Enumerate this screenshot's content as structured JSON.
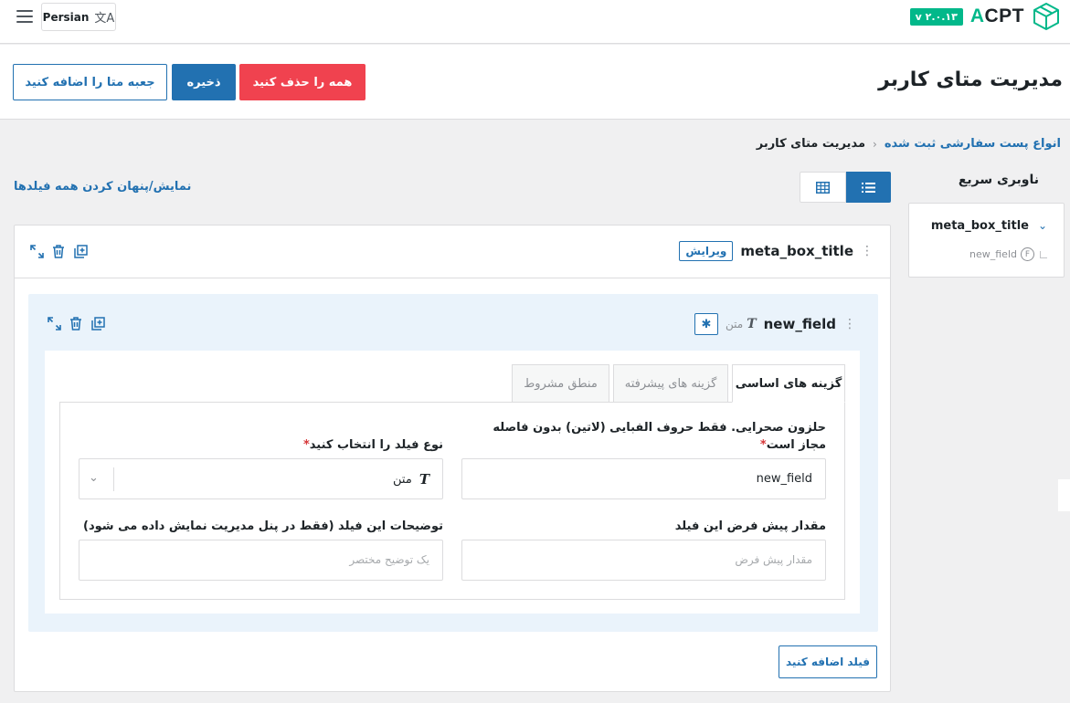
{
  "topbar": {
    "language_label": "Persian",
    "version": "۲.۰.۱۳ v",
    "logo_text_a": "A",
    "logo_text_rest": "CPT"
  },
  "header": {
    "title": "مدیریت متای کاربر",
    "delete_all_label": "همه را حذف کنید",
    "save_label": "ذخیره",
    "add_box_label": "جعبه متا را اضافه کنید"
  },
  "breadcrumb": {
    "link": "انواع پست سفارشی ثبت شده",
    "current": "مدیریت متای کاربر"
  },
  "quick_nav": {
    "title": "ناوبری سریع",
    "box_title": "meta_box_title",
    "field_name": "new_field",
    "field_badge": "F"
  },
  "toolbar": {
    "show_hide_label": "نمایش/پنهان کردن همه فیلدها"
  },
  "meta_box": {
    "title": "meta_box_title",
    "edit_label": "ویرایش",
    "field": {
      "name": "new_field",
      "type_label": "متن",
      "type_glyph": "T",
      "required_glyph": "✱",
      "tabs": [
        {
          "label": "گزینه های اساسی",
          "active": true
        },
        {
          "label": "گزینه های پیشرفته",
          "active": false
        },
        {
          "label": "منطق مشروط",
          "active": false
        }
      ],
      "name_label": "حلزون صحرایی. فقط حروف الفبایی (لاتین) بدون فاصله مجاز است",
      "name_value": "new_field",
      "type_select_label": "نوع فیلد را انتخاب کنید",
      "type_select_value": "متن",
      "default_label": "مقدار پیش فرض این فیلد",
      "default_placeholder": "مقدار پیش فرض",
      "desc_label": "توضیحات این فیلد (فقط در پنل مدیریت نمایش داده می شود)",
      "desc_placeholder": "یک توضیح مختصر",
      "required_mark": "*"
    },
    "add_field_label": "فیلد اضافه کنید"
  },
  "colors": {
    "accent": "#2271b1",
    "danger": "#f0424f",
    "brand_green": "#02b88a",
    "field_bg": "#eaf3fb"
  }
}
